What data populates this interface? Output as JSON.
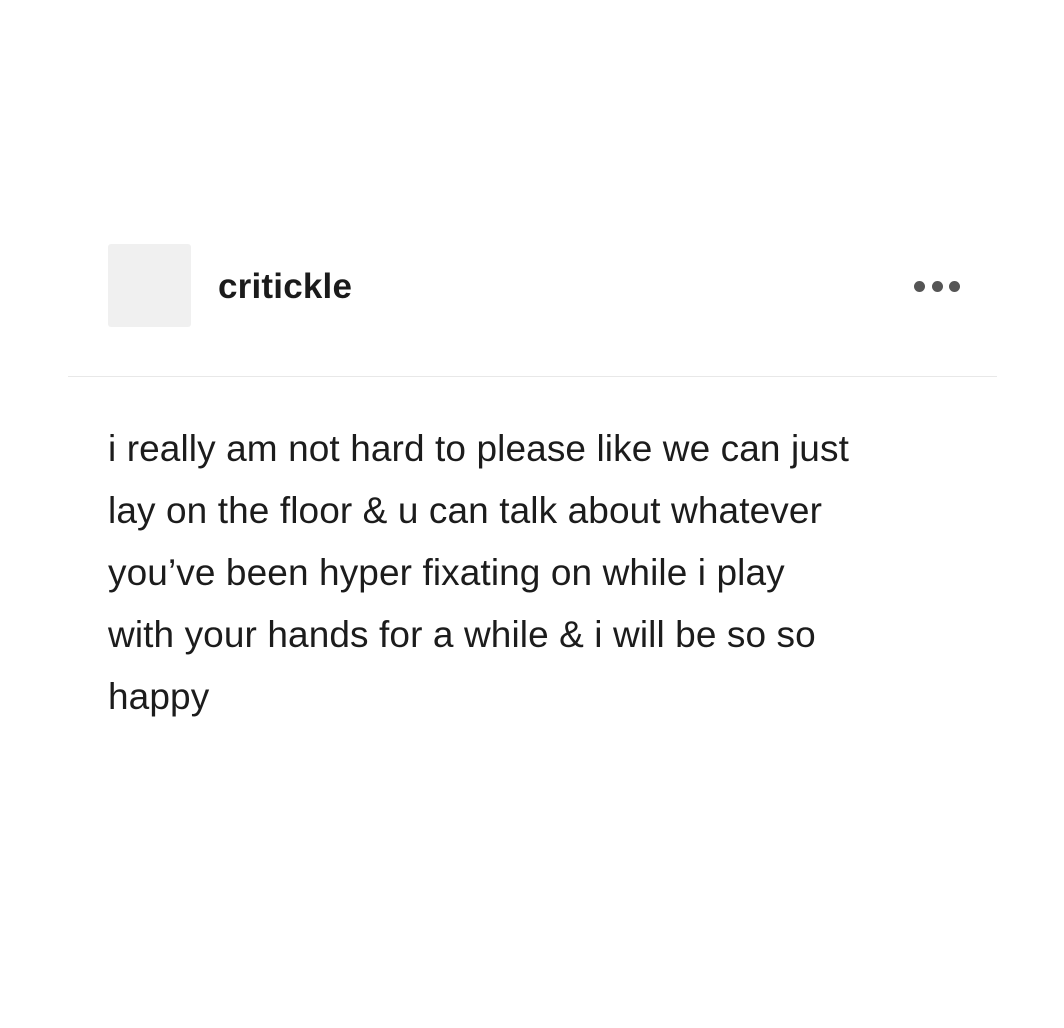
{
  "post": {
    "username": "critickle",
    "more_icon": "ellipsis-icon",
    "body_lines": [
      "i really am not hard to please like we can just",
      "lay on the floor & u can talk about whatever",
      "you’ve been hyper fixating on while i play",
      "with your hands for a while & i will be so so",
      "happy"
    ]
  },
  "colors": {
    "background": "#ffffff",
    "avatar_placeholder": "#f0f0f0",
    "text": "#1c1c1c",
    "icon": "#555555",
    "divider": "#e8e8e8"
  }
}
